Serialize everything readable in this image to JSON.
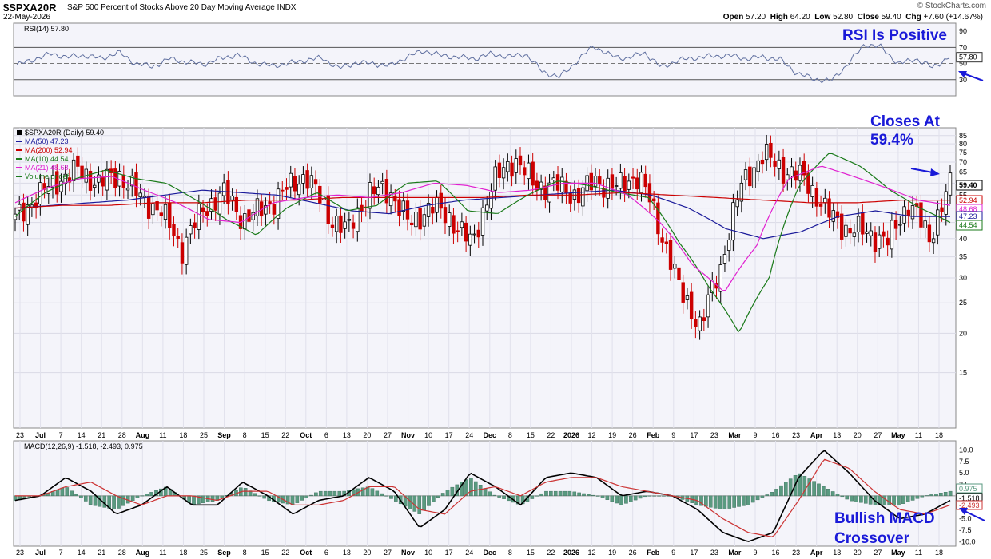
{
  "header": {
    "symbol": "$SPXA20R",
    "name": "S&P 500 Percent of Stocks Above 20 Day Moving Average",
    "exchange": "INDX",
    "date": "22-May-2026",
    "brand": "© StockCharts.com",
    "ohlc": {
      "open_label": "Open",
      "open": "57.20",
      "high_label": "High",
      "high": "64.20",
      "low_label": "Low",
      "low": "52.80",
      "close_label": "Close",
      "close": "59.40",
      "chg_label": "Chg",
      "chg": "+7.60 (+14.67%)"
    }
  },
  "colors": {
    "up": "#000000",
    "down": "#cc0000",
    "ma50": "#1a1a9a",
    "ma200": "#cc0000",
    "ma10": "#1a7a1a",
    "ma21": "#e020d0",
    "rsi": "#6070a0",
    "macd": "#000000",
    "signal": "#cc3333",
    "hist": "#5a9a80",
    "annotation": "#1a1ad8",
    "panel_bg": "#f4f4fa"
  },
  "annotations": {
    "rsi": "RSI Is Positive",
    "closes_line1": "Closes At",
    "closes_line2": "59.4%",
    "macd_line1": "Bullish MACD",
    "macd_line2": "Crossover"
  },
  "chart_data": [
    {
      "type": "line",
      "panel": "rsi",
      "legend": "RSI(14) 57.80",
      "last_value": "57.80",
      "ylim": [
        10,
        100
      ],
      "y_ticks": [
        30,
        50,
        70,
        90
      ],
      "reference_lines": [
        30,
        70
      ],
      "series": [
        {
          "name": "RSI(14)",
          "values": [
            48,
            55,
            62,
            58,
            60,
            56,
            64,
            50,
            46,
            56,
            52,
            49,
            56,
            61,
            51,
            47,
            50,
            54,
            57,
            44,
            51,
            50,
            47,
            58,
            66,
            60,
            58,
            56,
            62,
            58,
            62,
            40,
            33,
            52,
            72,
            60,
            56,
            64,
            45,
            54,
            57,
            59,
            60,
            56,
            58,
            55,
            38,
            31,
            28,
            49,
            74,
            70,
            49,
            56,
            45,
            58
          ]
        }
      ]
    },
    {
      "type": "candlestick",
      "panel": "price",
      "legend": [
        "$SPXA20R (Daily) 59.40",
        "MA(50) 47.23",
        "MA(200) 52.94",
        "MA(10) 44.54",
        "MA(21) 48.68",
        "Volume undef"
      ],
      "y_scale": "log",
      "ylim": [
        10,
        90
      ],
      "y_ticks": [
        15,
        20,
        25,
        30,
        35,
        40,
        45,
        50,
        55,
        60,
        65,
        70,
        75,
        80,
        85
      ],
      "x_tick_labels": [
        "23",
        "Jul",
        "7",
        "14",
        "21",
        "28",
        "Aug",
        "11",
        "18",
        "25",
        "Sep",
        "8",
        "15",
        "22",
        "Oct",
        "6",
        "13",
        "20",
        "27",
        "Nov",
        "10",
        "17",
        "24",
        "Dec",
        "8",
        "15",
        "22",
        "2026",
        "12",
        "19",
        "26",
        "Feb",
        "9",
        "17",
        "23",
        "Mar",
        "9",
        "16",
        "23",
        "Apr",
        "13",
        "20",
        "27",
        "May",
        "11",
        "18"
      ],
      "value_labels": [
        "59.40",
        "52.94",
        "48.68",
        "47.23",
        "44.54"
      ],
      "close": [
        46,
        54,
        61,
        66,
        60,
        64,
        54,
        49,
        37,
        49,
        56,
        46,
        50,
        57,
        64,
        48,
        42,
        56,
        57,
        44,
        51,
        46,
        38,
        60,
        72,
        59,
        59,
        55,
        61,
        58,
        64,
        43,
        27,
        21,
        33,
        60,
        74,
        66,
        62,
        49,
        43,
        42,
        39,
        52,
        40,
        59
      ],
      "series": [
        {
          "name": "MA(50)",
          "values": [
            50,
            51,
            52,
            53,
            55,
            57,
            56,
            55,
            52,
            49,
            48,
            51,
            53,
            54,
            55,
            56,
            57,
            55,
            50,
            43,
            40,
            42,
            47,
            49,
            47,
            47
          ]
        },
        {
          "name": "MA(200)",
          "values": [
            50,
            51,
            51,
            52,
            52,
            53,
            53,
            54,
            54,
            54,
            54,
            55,
            55,
            56,
            55,
            54,
            53,
            52,
            52,
            53,
            53
          ]
        },
        {
          "name": "MA(10)",
          "values": [
            47,
            56,
            62,
            66,
            62,
            60,
            53,
            46,
            41,
            50,
            56,
            49,
            51,
            60,
            61,
            49,
            48,
            55,
            61,
            59,
            56,
            54,
            39,
            28,
            20,
            30,
            59,
            75,
            68,
            57,
            50,
            45
          ]
        },
        {
          "name": "MA(21)",
          "values": [
            52,
            58,
            62,
            63,
            57,
            52,
            46,
            45,
            52,
            54,
            55,
            54,
            56,
            60,
            59,
            56,
            57,
            60,
            60,
            55,
            45,
            33,
            27,
            38,
            62,
            68,
            63,
            58,
            53,
            51
          ]
        }
      ]
    },
    {
      "type": "line",
      "panel": "macd",
      "legend": "MACD(12,26,9) -1.518, -2.493, 0.975",
      "value_labels": [
        "0.975",
        "-1.518",
        "-2.493"
      ],
      "ylim": [
        -11,
        12
      ],
      "y_ticks": [
        10.0,
        7.5,
        5.0,
        2.5,
        -2.5,
        -5.0,
        -7.5,
        -10.0
      ],
      "series": [
        {
          "name": "MACD",
          "values": [
            -1,
            0,
            4,
            1,
            -4,
            -2,
            2,
            -2,
            -2,
            3,
            0,
            -4,
            -1,
            0,
            4,
            1,
            -7,
            -3,
            5,
            2,
            -2,
            4,
            5,
            4,
            0,
            1,
            0,
            -3,
            -8,
            -10,
            -8,
            4,
            10,
            5,
            -1,
            -5,
            -4,
            -1
          ]
        },
        {
          "name": "Signal",
          "values": [
            0,
            0,
            2,
            3,
            0,
            -2,
            0,
            0,
            -1,
            1,
            1,
            -2,
            -2,
            -1,
            2,
            2,
            -3,
            -4,
            1,
            2,
            0,
            3,
            4,
            4,
            2,
            1,
            0,
            -1,
            -5,
            -8,
            -9,
            -1,
            8,
            6,
            1,
            -3,
            -4,
            -2
          ]
        },
        {
          "name": "Histogram",
          "values": [
            -1,
            0,
            2,
            -2,
            -3,
            0,
            2,
            -2,
            -1,
            2,
            -1,
            -2,
            1,
            1,
            2,
            -1,
            -4,
            1,
            4,
            0,
            -2,
            1,
            1,
            0,
            -2,
            0,
            0,
            -2,
            -3,
            -2,
            1,
            5,
            2,
            -1,
            -2,
            -2,
            0,
            1
          ]
        }
      ]
    }
  ]
}
